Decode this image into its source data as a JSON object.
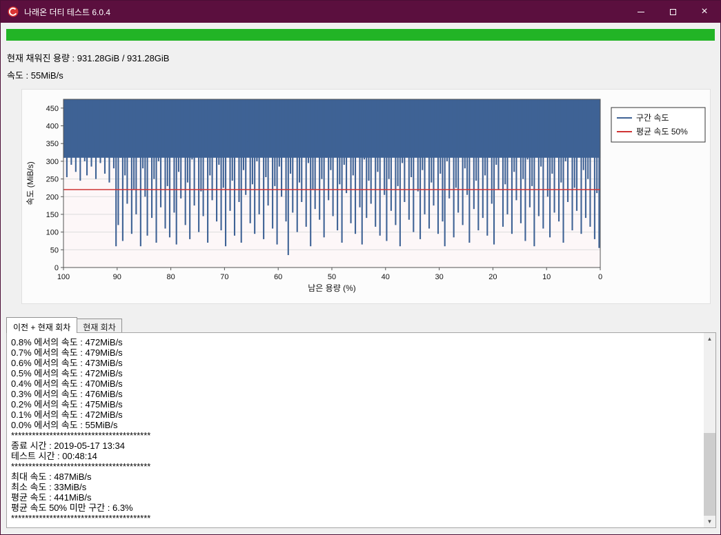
{
  "window": {
    "title": "나래온 더티 테스트 6.0.4",
    "controls": {
      "minimize": "최소화",
      "maximize": "최대화",
      "close": "×"
    }
  },
  "colors": {
    "titlebar": "#5b0f3e",
    "progress_green": "#22b426",
    "series_blue": "#3e6295",
    "avg_red": "#cf3333"
  },
  "status": {
    "progress_percent": 100,
    "capacity_label": "현재 채워진 용량 : 931.28GiB / 931.28GiB",
    "speed_label": "속도 : 55MiB/s"
  },
  "chart_data": {
    "type": "line",
    "title": "",
    "xlabel": "남은 용량 (%)",
    "ylabel": "속도 (MiB/s)",
    "x_range": [
      100,
      0
    ],
    "y_range": [
      0,
      475
    ],
    "x_ticks": [
      100,
      90,
      80,
      70,
      60,
      50,
      40,
      30,
      20,
      10,
      0
    ],
    "y_ticks": [
      0,
      50,
      100,
      150,
      200,
      250,
      300,
      350,
      400,
      450
    ],
    "grid": true,
    "plot_bg": "#fdf7f8",
    "series_color": "#3e6295",
    "avg_line_color": "#cf3333",
    "avg_50_value": 220,
    "legend": [
      "구간 속도",
      "평균 속도 50%"
    ],
    "legend_position": "right-outside",
    "ceiling": 478,
    "solid_band_bottom": 310,
    "dip_values": [
      310,
      255,
      340,
      290,
      365,
      270,
      320,
      245,
      355,
      300,
      260,
      335,
      285,
      370,
      250,
      315,
      295,
      345,
      265,
      330,
      240,
      360,
      280,
      60,
      120,
      310,
      75,
      260,
      180,
      340,
      95,
      220,
      150,
      365,
      60,
      280,
      200,
      90,
      330,
      140,
      250,
      70,
      300,
      170,
      380,
      110,
      230,
      85,
      320,
      155,
      65,
      270,
      195,
      350,
      120,
      240,
      80,
      305,
      175,
      360,
      100,
      215,
      145,
      330,
      70,
      260,
      190,
      375,
      130,
      290,
      105,
      225,
      60,
      340,
      160,
      245,
      90,
      315,
      185,
      70,
      275,
      205,
      355,
      125,
      235,
      95,
      300,
      150,
      365,
      80,
      255,
      175,
      320,
      110,
      230,
      65,
      285,
      200,
      345,
      130,
      35,
      265,
      155,
      335,
      100,
      240,
      185,
      370,
      115,
      295,
      60,
      220,
      165,
      350,
      135,
      250,
      85,
      310,
      190,
      275,
      145,
      325,
      105,
      235,
      70,
      290,
      210,
      360,
      125,
      260,
      95,
      330,
      170,
      65,
      305,
      140,
      245,
      180,
      355,
      115,
      270,
      90,
      315,
      205,
      75,
      250,
      160,
      340,
      120,
      230,
      60,
      295,
      185,
      365,
      135,
      255,
      100,
      320,
      215,
      80,
      275,
      150,
      330,
      110,
      240,
      175,
      350,
      95,
      265,
      130,
      60,
      300,
      195,
      345,
      85,
      225,
      155,
      315,
      120,
      280,
      205,
      70,
      335,
      165,
      245,
      105,
      355,
      140,
      260,
      90,
      310,
      180,
      65,
      290,
      220,
      360,
      115,
      235,
      150,
      325,
      95,
      270,
      190,
      340,
      125,
      250,
      75,
      305,
      170,
      230,
      60,
      345,
      145,
      285,
      110,
      320,
      200,
      85,
      265,
      155,
      350,
      130,
      240,
      70,
      300,
      185,
      330,
      105,
      225,
      160,
      365,
      95,
      275,
      140,
      250,
      115,
      335,
      80,
      210,
      55
    ]
  },
  "tabs": [
    {
      "label": "이전 + 현재 회차",
      "active": true
    },
    {
      "label": "현재 회차",
      "active": false
    }
  ],
  "log": {
    "lines": [
      "0.8% 에서의 속도 : 472MiB/s",
      "0.7% 에서의 속도 : 479MiB/s",
      "0.6% 에서의 속도 : 473MiB/s",
      "0.5% 에서의 속도 : 472MiB/s",
      "0.4% 에서의 속도 : 470MiB/s",
      "0.3% 에서의 속도 : 476MiB/s",
      "0.2% 에서의 속도 : 475MiB/s",
      "0.1% 에서의 속도 : 472MiB/s",
      "0.0% 에서의 속도 : 55MiB/s",
      "****************************************",
      "종료 시간 : 2019-05-17 13:34",
      "테스트 시간 : 00:48:14",
      "****************************************",
      "최대 속도 : 487MiB/s",
      "최소 속도 : 33MiB/s",
      "평균 속도 : 441MiB/s",
      "평균 속도 50% 미만 구간 : 6.3%",
      "****************************************"
    ]
  }
}
